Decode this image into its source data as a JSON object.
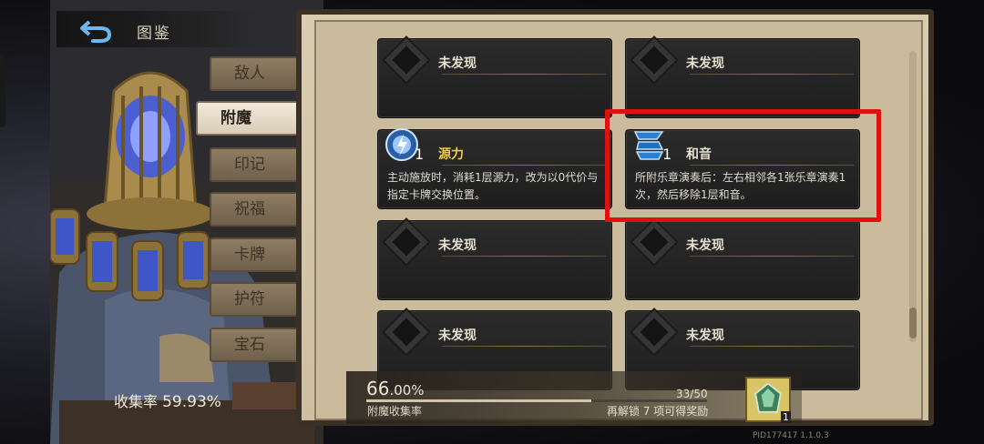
{
  "header": {
    "title": "图鉴"
  },
  "tabs": [
    {
      "label": "敌人",
      "active": false
    },
    {
      "label": "附魔",
      "active": true
    },
    {
      "label": "印记",
      "active": false
    },
    {
      "label": "祝福",
      "active": false
    },
    {
      "label": "卡牌",
      "active": false
    },
    {
      "label": "护符",
      "active": false
    },
    {
      "label": "宝石",
      "active": false
    }
  ],
  "collection": {
    "label": "收集率",
    "value": "59.93%"
  },
  "cards": [
    {
      "title": "未发现",
      "discovered": false
    },
    {
      "title": "未发现",
      "discovered": false
    },
    {
      "title": "源力",
      "discovered": true,
      "count": "1",
      "desc": "主动施放时，消耗1层源力，改为以0代价与指定卡牌交换位置。",
      "icon": "source-orb-icon"
    },
    {
      "title": "和音",
      "discovered": true,
      "count": "1",
      "desc": "所附乐章演奏后：左右相邻各1张乐章演奏1次，然后移除1层和音。",
      "icon": "harmony-scroll-icon",
      "highlighted": true
    },
    {
      "title": "未发现",
      "discovered": false
    },
    {
      "title": "未发现",
      "discovered": false
    },
    {
      "title": "未发现",
      "discovered": false
    },
    {
      "title": "未发现",
      "discovered": false
    }
  ],
  "progress": {
    "percent_int": "66",
    "percent_dec": ".00%",
    "label": "附魔收集率",
    "count": "33/50",
    "fraction": 0.66,
    "reward_hint": "再解锁 7 项可得奖励",
    "reward_count": "1"
  },
  "version": "PID177417  1.1.0.3",
  "colors": {
    "highlight": "#e01010",
    "gold_title": "#f0c94a"
  }
}
